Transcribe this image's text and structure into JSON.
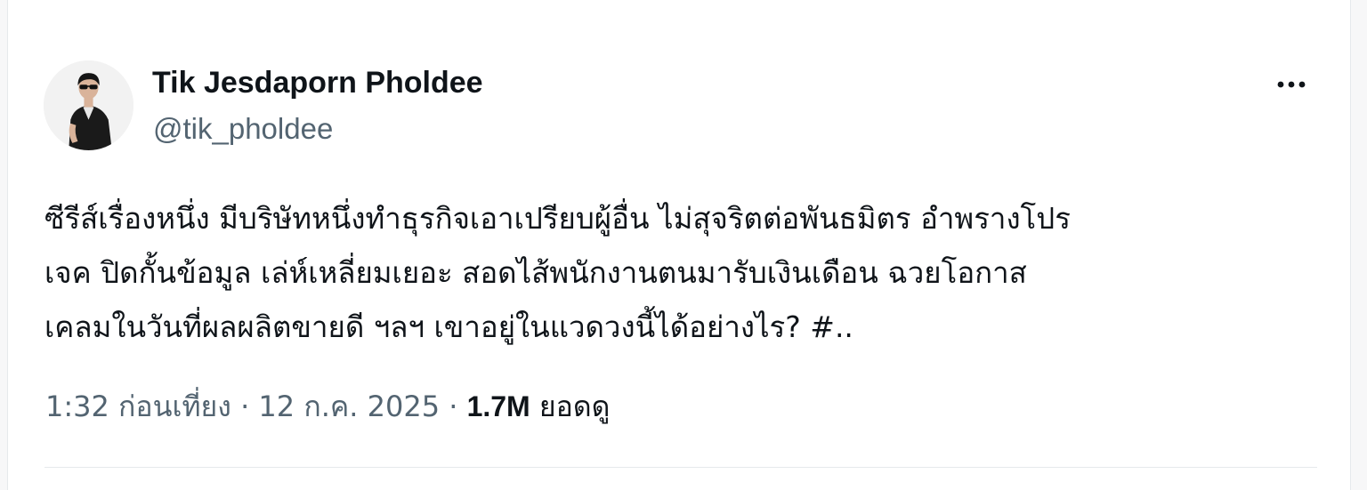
{
  "author": {
    "display_name": "Tik Jesdaporn Pholdee",
    "handle": "@tik_pholdee",
    "avatar_icon": "profile-photo"
  },
  "more_icon": "more-horizontal-icon",
  "tweet": {
    "lines": [
      "ซีรีส์เรื่องหนึ่ง มีบริษัทหนึ่งทำธุรกิจเอาเปรียบผู้อื่น ไม่สุจริตต่อพันธมิตร อำพรางโปร",
      "เจค ปิดกั้นข้อมูล เล่ห์เหลี่ยมเยอะ  สอดไส้พนักงานตนมารับเงินเดือน ฉวยโอกาส",
      "เคลมในวันที่ผลผลิตขายดี ฯลฯ เขาอยู่ในแวดวงนี้ได้อย่างไร? #.."
    ]
  },
  "meta": {
    "time": "1:32 ก่อนเที่ยง",
    "separator": "·",
    "date": "12 ก.ค. 2025",
    "views_count": "1.7M",
    "views_label": "ยอดดู"
  },
  "colors": {
    "text_primary": "#0f1419",
    "text_secondary": "#536471",
    "border": "#e6e9ec"
  }
}
